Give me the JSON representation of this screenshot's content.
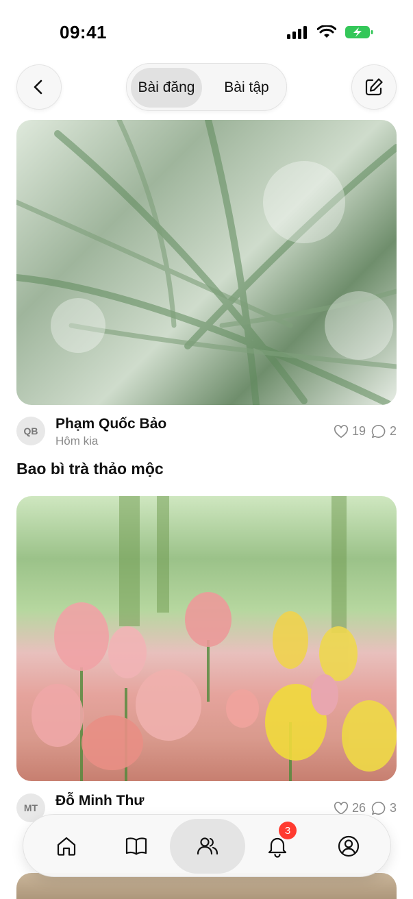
{
  "status_bar": {
    "time": "09:41"
  },
  "header": {
    "tabs": [
      {
        "label": "Bài đăng",
        "active": true
      },
      {
        "label": "Bài tập",
        "active": false
      }
    ]
  },
  "posts": [
    {
      "author_initials": "QB",
      "author": "Phạm Quốc Bảo",
      "time": "Hôm kia",
      "likes": "19",
      "comments": "2",
      "title": "Bao bì trà thảo mộc"
    },
    {
      "author_initials": "MT",
      "author": "Đỗ Minh Thư",
      "time": "",
      "likes": "26",
      "comments": "3",
      "title": ""
    }
  ],
  "bottom_nav": {
    "items": [
      "home-icon",
      "book-icon",
      "users-icon",
      "bell-icon",
      "profile-icon"
    ],
    "active": "users-icon",
    "notification_badge": "3"
  },
  "colors": {
    "accent_badge": "#ff3b30",
    "battery": "#34c759"
  }
}
